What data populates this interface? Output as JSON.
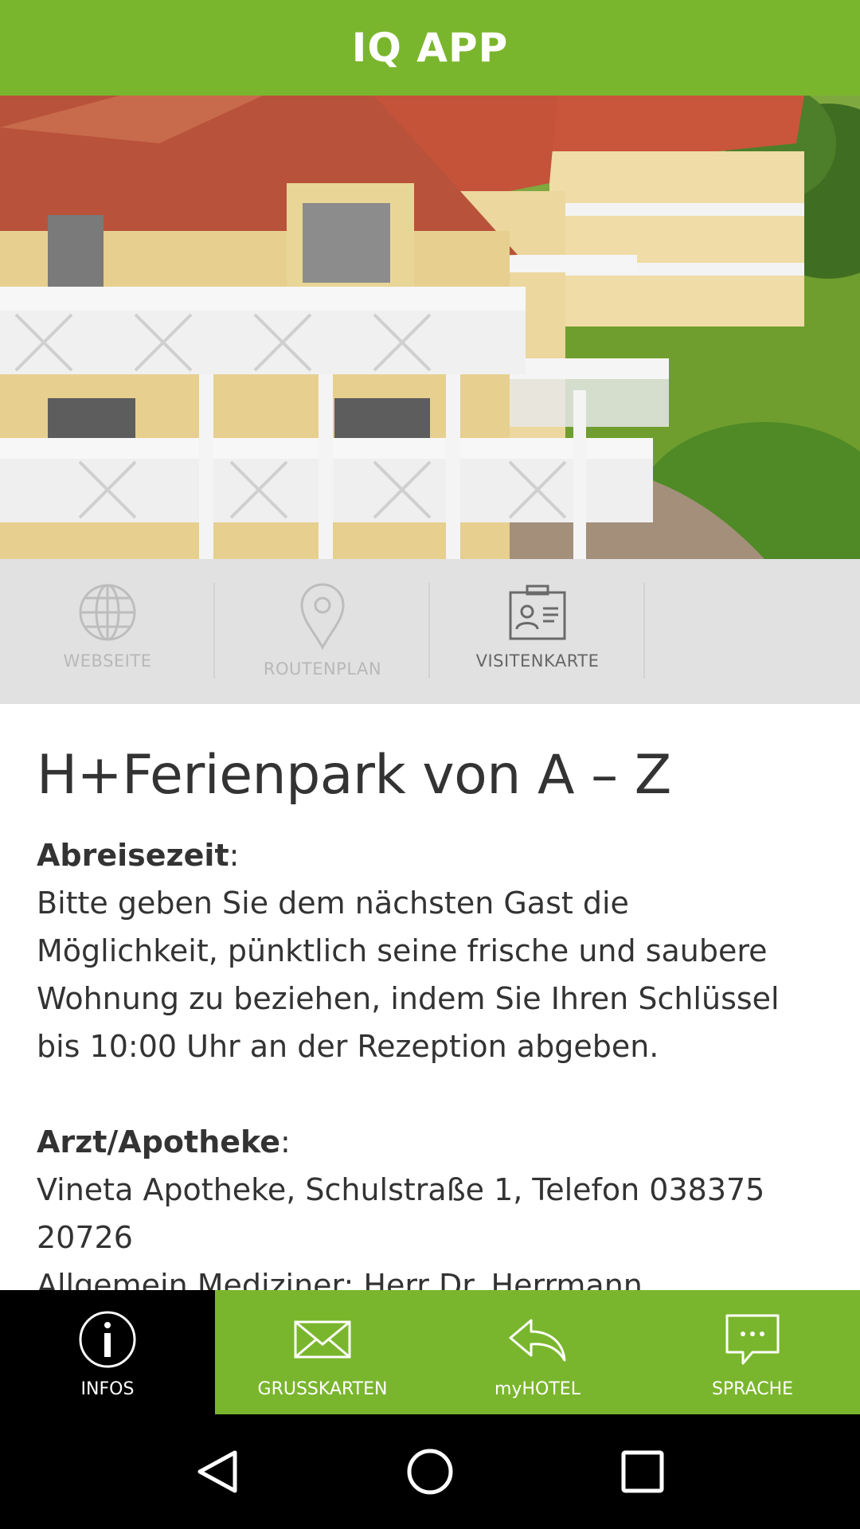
{
  "header": {
    "title": "IQ APP"
  },
  "hero": {
    "image": "hotel-apartment-building-photo"
  },
  "actions": [
    {
      "label": "WEBSEITE",
      "icon": "globe-icon",
      "enabled": false
    },
    {
      "label": "ROUTENPLAN",
      "icon": "map-pin-icon",
      "enabled": false
    },
    {
      "label": "VISITENKARTE",
      "icon": "contact-card-icon",
      "enabled": true
    }
  ],
  "content": {
    "title": "H+Ferienpark von A – Z",
    "sections": [
      {
        "heading": "Abreisezeit",
        "heading_suffix": ":",
        "lines": [
          "Bitte geben Sie dem nächsten Gast die",
          "Möglichkeit, pünktlich seine frische und saubere",
          "Wohnung zu beziehen, indem Sie Ihren Schlüssel",
          "bis 10:00 Uhr an der Rezeption abgeben."
        ]
      },
      {
        "heading": "Arzt/Apotheke",
        "heading_suffix": ":",
        "lines": [
          "Vineta Apotheke, Schulstraße 1, Telefon 038375",
          "20726",
          "Allgemein Mediziner: Herr Dr. Herrmann"
        ]
      }
    ]
  },
  "bottom_nav": [
    {
      "label": "INFOS",
      "icon": "info-icon",
      "active": true
    },
    {
      "label": "GRUSSKARTEN",
      "icon": "envelope-icon",
      "active": false
    },
    {
      "label": "myHOTEL",
      "icon": "reply-arrow-icon",
      "active": false
    },
    {
      "label": "SPRACHE",
      "icon": "chat-bubble-icon",
      "active": false
    }
  ],
  "colors": {
    "brand": "#7ab62d",
    "active_tab": "#000000",
    "action_bar": "#e1e1e1"
  }
}
